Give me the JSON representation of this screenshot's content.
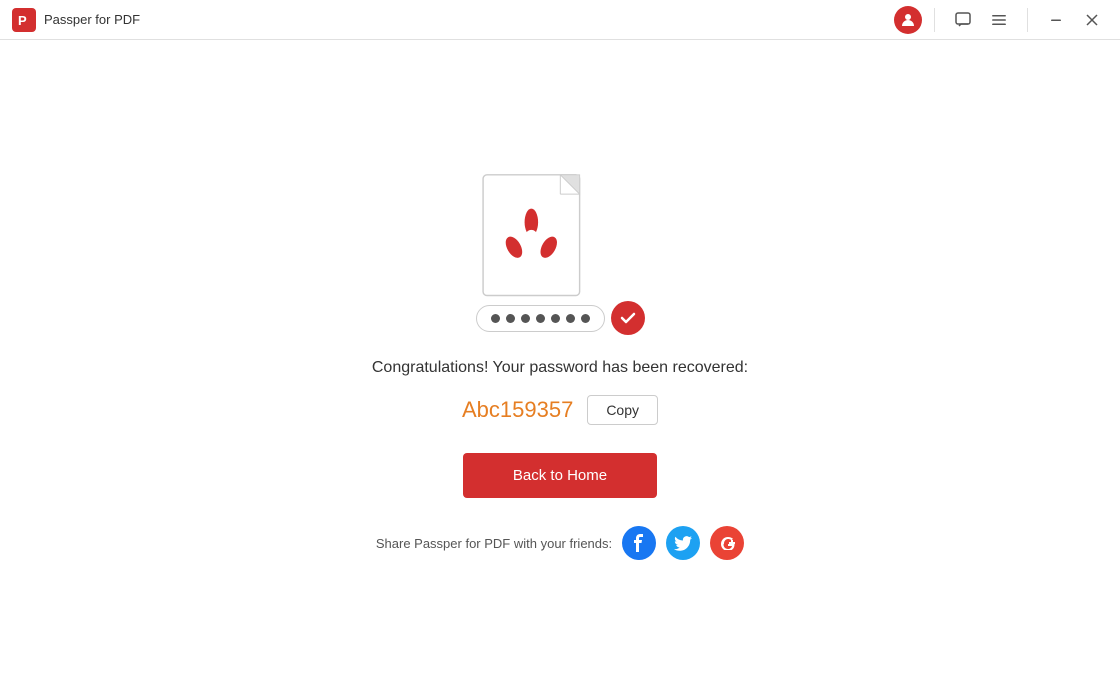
{
  "titleBar": {
    "appName": "Passper for PDF",
    "logoAlt": "Passper logo"
  },
  "main": {
    "congratsText": "Congratulations! Your password has been recovered:",
    "passwordValue": "Abc159357",
    "copyLabel": "Copy",
    "backToHomeLabel": "Back to Home",
    "shareText": "Share Passper for PDF with your friends:",
    "dots": [
      "•",
      "•",
      "•",
      "•",
      "•",
      "•",
      "•"
    ]
  },
  "colors": {
    "brand": "#d32f2f",
    "passwordOrange": "#e67e22",
    "facebook": "#1877f2",
    "twitter": "#1da1f2",
    "googleplus": "#ea4335"
  }
}
